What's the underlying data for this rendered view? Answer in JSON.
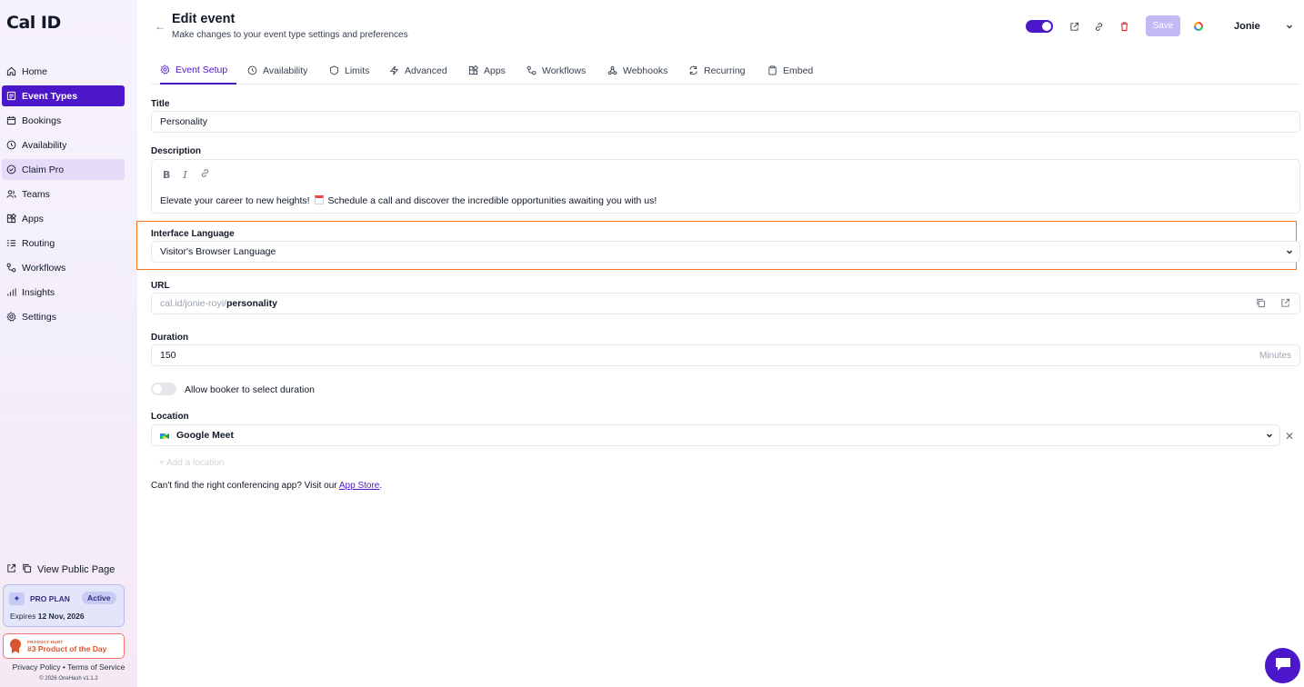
{
  "brand": {
    "logo_text": "Cal ID",
    "accent": "#4c16c9",
    "highlight": "#f97316"
  },
  "sidebar": {
    "items": [
      {
        "label": "Home",
        "icon": "home-icon"
      },
      {
        "label": "Event Types",
        "icon": "event-types-icon",
        "active": true
      },
      {
        "label": "Bookings",
        "icon": "calendar-icon"
      },
      {
        "label": "Availability",
        "icon": "clock-icon"
      },
      {
        "label": "Claim Pro",
        "icon": "badge-icon"
      },
      {
        "label": "Teams",
        "icon": "users-icon"
      },
      {
        "label": "Apps",
        "icon": "grid-icon"
      },
      {
        "label": "Routing",
        "icon": "list-icon"
      },
      {
        "label": "Workflows",
        "icon": "workflow-icon"
      },
      {
        "label": "Insights",
        "icon": "chart-icon"
      },
      {
        "label": "Settings",
        "icon": "gear-icon"
      }
    ],
    "public_page_label": "View Public Page",
    "plan": {
      "name": "PRO PLAN",
      "status": "Active",
      "expires_prefix": "Expires",
      "expires_date": "12 Nov, 2026"
    },
    "product_hunt": {
      "small": "PRODUCT HUNT",
      "label": "#3 Product of the Day"
    },
    "footer": {
      "privacy": "Privacy Policy",
      "sep": "•",
      "terms": "Terms of Service",
      "copyright": "© 2026 OneHash v1.1.2"
    }
  },
  "header": {
    "title": "Edit event",
    "subtitle": "Make changes to your event type settings and preferences",
    "save_label": "Save",
    "user_name": "Jonie"
  },
  "tabs": [
    {
      "label": "Event Setup",
      "icon": "gear-icon",
      "active": true
    },
    {
      "label": "Availability",
      "icon": "clock-icon"
    },
    {
      "label": "Limits",
      "icon": "shield-icon"
    },
    {
      "label": "Advanced",
      "icon": "bolt-icon"
    },
    {
      "label": "Apps",
      "icon": "grid-icon"
    },
    {
      "label": "Workflows",
      "icon": "workflow-icon"
    },
    {
      "label": "Webhooks",
      "icon": "webhook-icon"
    },
    {
      "label": "Recurring",
      "icon": "repeat-icon"
    },
    {
      "label": "Embed",
      "icon": "clipboard-icon"
    }
  ],
  "form": {
    "title_label": "Title",
    "title_value": "Personality",
    "description_label": "Description",
    "description_before": "Elevate your career to new heights!",
    "description_after": "Schedule a call and discover the incredible opportunities awaiting you with us!",
    "language_label": "Interface Language",
    "language_value": "Visitor's Browser Language",
    "url_label": "URL",
    "url_prefix": "cal.id/jonie-royi/",
    "url_slug": "personality",
    "duration_label": "Duration",
    "duration_value": "150",
    "duration_suffix": "Minutes",
    "toggle_label": "Allow booker to select duration",
    "location_label": "Location",
    "location_value": "Google Meet",
    "add_location": "+ Add a location",
    "help_prefix": "Can't find the right conferencing app? Visit our",
    "help_link": "App Store",
    "help_suffix": "."
  }
}
